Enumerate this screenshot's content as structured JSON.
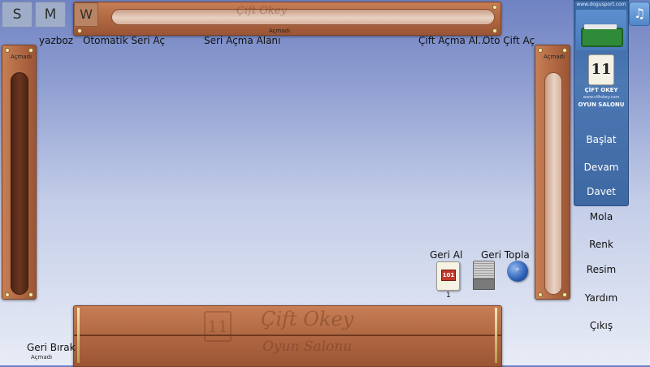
{
  "top_buttons": [
    {
      "label": "S"
    },
    {
      "label": "M"
    },
    {
      "label": "W"
    }
  ],
  "labels": {
    "player_name": "yazboz",
    "auto_series": "Otomatik Seri Aç",
    "series_area": "Seri Açma Alanı",
    "pair_area": "Çift Açma Al...",
    "auto_pair": "Oto Çift Aç",
    "undo": "Geri Al",
    "collect": "Geri Topla",
    "discard": "Geri Bırak",
    "tile_count": "1"
  },
  "status": {
    "top_rack": "Açmadı",
    "left_rack": "Açmadı",
    "right_rack": "Açmadı",
    "bottom": "Açmadı"
  },
  "promo": {
    "site": "www.dogusport.com",
    "title": "ÇİFT OKEY",
    "url": "www.ciftokey.com",
    "subtitle": "OYUN SALONU",
    "tile_text": "11"
  },
  "tile": {
    "value": "101"
  },
  "watermark": {
    "line1": "Çift Okey",
    "line2": "Oyun Salonu"
  },
  "menu": [
    {
      "label": "Başlat"
    },
    {
      "label": "Devam"
    },
    {
      "label": "Davet"
    },
    {
      "label": "Mola"
    },
    {
      "label": "Renk"
    },
    {
      "label": "Resim"
    },
    {
      "label": "Yardım"
    },
    {
      "label": "Çıkış"
    }
  ],
  "icons": {
    "music": "music-note-icon"
  }
}
